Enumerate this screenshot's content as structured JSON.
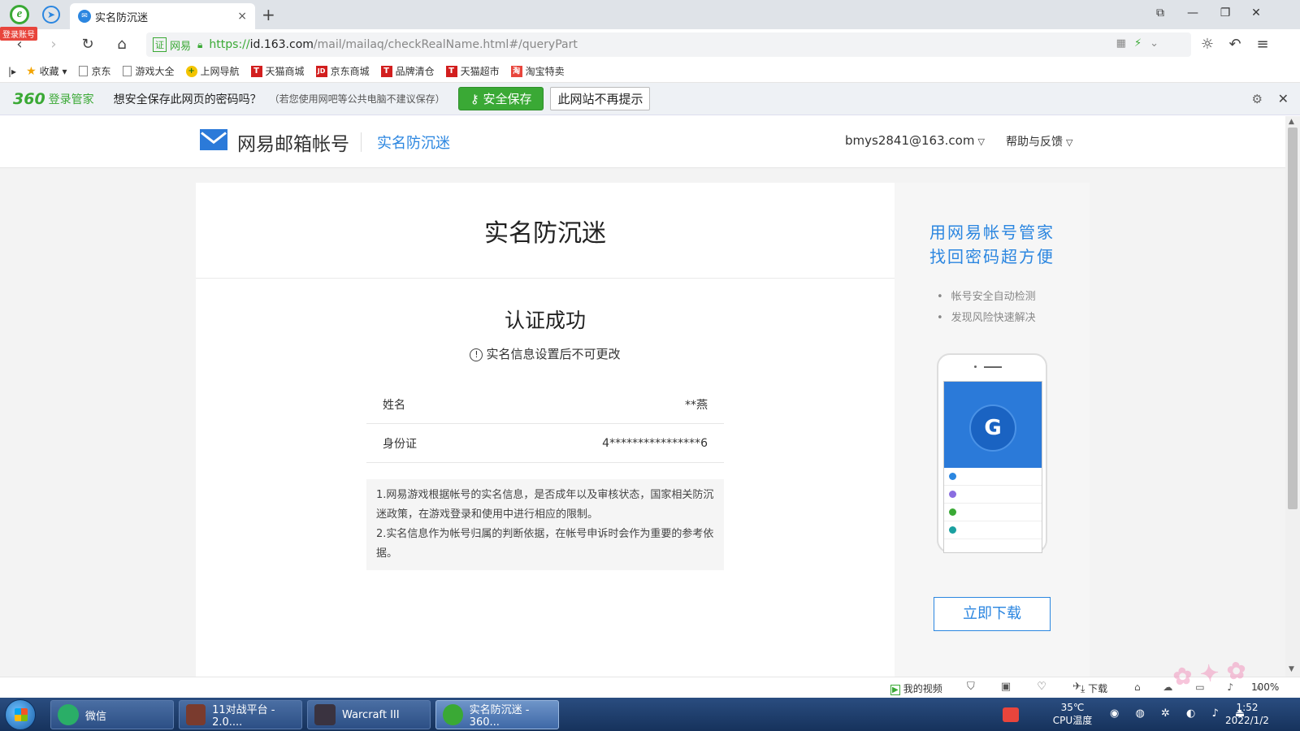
{
  "browser": {
    "login_badge": "登录账号",
    "tab_title": "实名防沉迷",
    "tab_close": "×",
    "new_tab": "+",
    "window_controls": [
      "⧉",
      "—",
      "❐",
      "✕"
    ]
  },
  "address": {
    "cert_badge": "证",
    "cert_label": "网易",
    "url_https": "https://",
    "url_host": "id.163.com",
    "url_rest": "/mail/mailaq/checkRealName.html#/queryPart"
  },
  "bookmarks": [
    {
      "label": "收藏",
      "icon": "star-icon"
    },
    {
      "label": "京东",
      "icon": "page-icon"
    },
    {
      "label": "游戏大全",
      "icon": "page-icon"
    },
    {
      "label": "上网导航",
      "icon": "navigation-icon",
      "color": "#f3c400"
    },
    {
      "label": "天猫商城",
      "icon": "tmall-icon",
      "color": "#d21e1e",
      "glyph": "T"
    },
    {
      "label": "京东商城",
      "icon": "jd-icon",
      "color": "#d21e1e",
      "glyph": "JD"
    },
    {
      "label": "品牌清仓",
      "icon": "tmall-icon",
      "color": "#d21e1e",
      "glyph": "T"
    },
    {
      "label": "天猫超市",
      "icon": "tmall-icon",
      "color": "#d21e1e",
      "glyph": "T"
    },
    {
      "label": "淘宝特卖",
      "icon": "taobao-icon",
      "color": "#e8453c",
      "glyph": "淘"
    }
  ],
  "password_bar": {
    "brand": "360",
    "brand_sub": "登录管家",
    "question": "想安全保存此网页的密码吗？",
    "hint": "（若您使用网吧等公共电脑不建议保存）",
    "save_button": "安全保存",
    "never_button": "此网站不再提示"
  },
  "site_header": {
    "title": "网易邮箱帐号",
    "subtitle": "实名防沉迷",
    "user": "bmys2841@163.com",
    "help": "帮助与反馈"
  },
  "main": {
    "card_title": "实名防沉迷",
    "success_title": "认证成功",
    "notice": "实名信息设置后不可更改",
    "rows": [
      {
        "label": "姓名",
        "value": "**燕"
      },
      {
        "label": "身份证",
        "value": "4****************6"
      }
    ],
    "rules": [
      "1.网易游戏根据帐号的实名信息，是否成年以及审核状态，国家相关防沉迷政策，在游戏登录和使用中进行相应的限制。",
      "2.实名信息作为帐号归属的判断依据，在帐号申诉时会作为重要的参考依据。"
    ]
  },
  "side": {
    "title_line1": "用网易帐号管家",
    "title_line2": "找回密码超方便",
    "features": [
      "帐号安全自动检测",
      "发现风险快速解决"
    ],
    "download_button": "立即下载"
  },
  "statusbar": {
    "my_video": "我的视频",
    "download": "下载",
    "zoom": "100%"
  },
  "taskbar": {
    "tasks": [
      {
        "label": "微信",
        "color": "#2aae67"
      },
      {
        "label": "11对战平台 - 2.0....",
        "color": "#7a3b2e"
      },
      {
        "label": "Warcraft III",
        "color": "#3a3340"
      },
      {
        "label": "实名防沉迷 - 360...",
        "color": "#3aa935"
      }
    ],
    "temp": "35℃",
    "temp_label": "CPU温度",
    "time": "1:52",
    "date": "2022/1/2"
  }
}
